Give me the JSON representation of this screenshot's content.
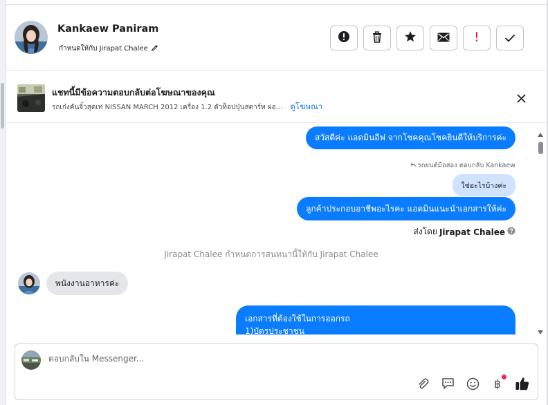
{
  "header": {
    "contact_name": "Kankaew Paniram",
    "assigned_to": "กำหนดให้กับ Jirapat Chalee",
    "actions": [
      {
        "name": "report-icon",
        "label": "!"
      },
      {
        "name": "trash-icon",
        "label": ""
      },
      {
        "name": "star-icon",
        "label": ""
      },
      {
        "name": "envelope-icon",
        "label": ""
      },
      {
        "name": "important-icon",
        "label": "!"
      },
      {
        "name": "checkmark-icon",
        "label": ""
      }
    ]
  },
  "ad_banner": {
    "title": "แชทนี้มีข้อความตอบกลับต่อโฆษณาของคุณ",
    "subtitle": "รถเก๋งคันจิ๋วสุดเท่ NISSAN MARCH 2012 เครื่อง 1.2 ตัวท็อปปุ่นสตาร์ท ผ่อ...",
    "link": "ดูโฆษณา"
  },
  "thread": {
    "messages": [
      {
        "direction": "out",
        "text": "สวัสดีค่ะ แอดมินอีฟ จากโชคคุณโชคยินดีให้บริการค่ะ"
      },
      {
        "reply_label": "รถยนต์มือสอง ตอบกลับ Kankaew"
      },
      {
        "quoted_text": "ใช่อะไรบ้างค่ะ"
      },
      {
        "direction": "out",
        "text": "ลูกค้าประกอบอาชีพอะไรคะ แอดมินแนะนำเอกสารให้ค่ะ"
      },
      {
        "sent_by_prefix": "ส่งโดย",
        "sent_by_name": "Jirapat Chalee"
      },
      {
        "system": "Jirapat Chalee กำหนดการสนทนานี้ให้กับ Jirapat Chalee"
      },
      {
        "direction": "in",
        "text": "พนังงานอาหารค่ะ"
      },
      {
        "direction": "out",
        "line1": "เอกสารที่ต้องใช้ในการออกรถ",
        "line2": "1)บัตรประชาชน"
      }
    ]
  },
  "composer": {
    "placeholder": "ตอบกลับใน Messenger...",
    "icons": [
      "paperclip-icon",
      "chat-bubble-icon",
      "smile-icon",
      "baht-icon",
      "thumbs-up-icon"
    ],
    "baht_symbol": "฿"
  },
  "colors": {
    "accent": "#0a7cff",
    "link": "#1877f2",
    "incoming_bubble": "#e4e6eb",
    "quote_bubble": "#cfe3ff",
    "important": "#e41e3f"
  }
}
